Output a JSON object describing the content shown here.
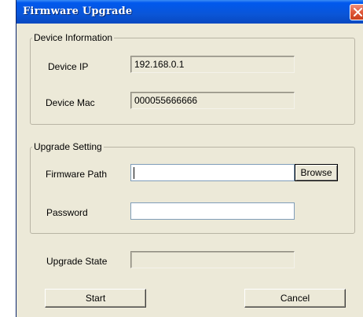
{
  "window": {
    "title": "Firmware Upgrade"
  },
  "device_info": {
    "legend": "Device Information",
    "ip_label": "Device IP",
    "ip_value": "192.168.0.1",
    "mac_label": "Device Mac",
    "mac_value": "000055666666"
  },
  "upgrade_setting": {
    "legend": "Upgrade Setting",
    "path_label": "Firmware Path",
    "path_value": "",
    "browse_label": "Browse",
    "password_label": "Password",
    "password_value": ""
  },
  "upgrade_state": {
    "label": "Upgrade State",
    "value": ""
  },
  "buttons": {
    "start_label": "Start",
    "cancel_label": "Cancel"
  },
  "icons": {
    "close": "close-icon"
  }
}
